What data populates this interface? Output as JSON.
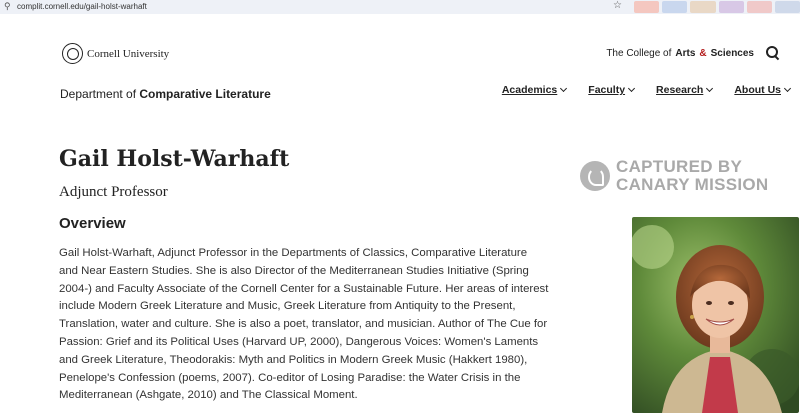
{
  "browser": {
    "url": "complit.cornell.edu/gail-holst-warhaft"
  },
  "header": {
    "university_name": "Cornell University",
    "college_prefix": "The College of ",
    "college_arts": "Arts",
    "college_amp": "&",
    "college_sciences": "Sciences",
    "dept_prefix": "Department of ",
    "dept_name": "Comparative Literature"
  },
  "nav": {
    "items": [
      {
        "label": "Academics"
      },
      {
        "label": "Faculty"
      },
      {
        "label": "Research"
      },
      {
        "label": "About Us"
      }
    ]
  },
  "profile": {
    "name": "Gail Holst-Warhaft",
    "title": "Adjunct Professor",
    "section_heading": "Overview",
    "bio": "Gail Holst-Warhaft, Adjunct Professor in the Departments of Classics, Comparative Literature and Near Eastern Studies. She is also Director of the Mediterranean Studies Initiative (Spring 2004-) and Faculty Associate of the Cornell Center for a Sustainable Future. Her areas of interest include Modern Greek Literature and Music, Greek Literature from Antiquity to the Present, Translation, water and culture. She is also a poet, translator, and musician. Author of The Cue for Passion: Grief and its Political Uses (Harvard UP, 2000), Dangerous Voices: Women's Laments and Greek Literature, Theodorakis: Myth and Politics in Modern Greek Music (Hakkert 1980), Penelope's Confession (poems, 2007). Co-editor of Losing Paradise: the Water Crisis in the Mediterranean (Ashgate, 2010) and The Classical Moment."
  },
  "watermark": {
    "line1": "CAPTURED BY",
    "line2": "CANARY MISSION"
  },
  "colors": {
    "accent_red": "#b31b1b",
    "text": "#222222",
    "watermark_gray": "#a9a9a9"
  }
}
